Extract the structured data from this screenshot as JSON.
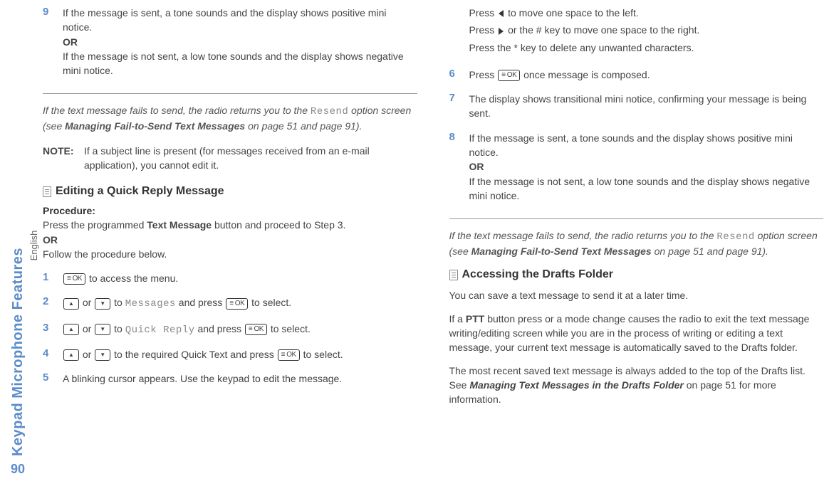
{
  "sidebar": {
    "title": "Keypad Microphone Features",
    "language": "English",
    "page_number": "90"
  },
  "left": {
    "step9_num": "9",
    "step9_text_a": "If the message is sent, a tone sounds and the display shows positive mini notice.",
    "step9_or": "OR",
    "step9_text_b": "If the message is not sent, a low tone sounds and the display shows negative mini notice.",
    "fail_note_a": "If the text message fails to send, the radio returns you to the ",
    "fail_note_code": "Resend",
    "fail_note_b": " option screen (see ",
    "fail_note_bold": "Managing Fail-to-Send Text Messages",
    "fail_note_c": " on page 51 and page 91).",
    "note_label": "NOTE:",
    "note_text": "If a subject line is present (for messages received from an e-mail application), you cannot edit it.",
    "heading": "Editing a Quick Reply Message",
    "proc_label": "Procedure:",
    "proc_intro_a": "Press the programmed ",
    "proc_intro_bold": "Text Message",
    "proc_intro_b": " button and proceed to Step 3.",
    "proc_or": "OR",
    "proc_follow": "Follow the procedure below.",
    "s1_num": "1",
    "s1_text": " to access the menu.",
    "s2_num": "2",
    "s2_a": " or ",
    "s2_b": " to ",
    "s2_code": "Messages",
    "s2_c": " and press ",
    "s2_d": " to select.",
    "s3_num": "3",
    "s3_a": " or ",
    "s3_b": " to ",
    "s3_code": "Quick Reply",
    "s3_c": " and press ",
    "s3_d": " to select.",
    "s4_num": "4",
    "s4_a": " or ",
    "s4_b": " to the required Quick Text and press ",
    "s4_c": " to select.",
    "s5_num": "5",
    "s5_text": "A blinking cursor appears. Use the keypad to edit the message."
  },
  "right": {
    "line1_a": "Press ",
    "line1_b": " to move one space to the left.",
    "line2_a": "Press ",
    "line2_b": " or the # key to move one space to the right.",
    "line3": "Press the * key to delete any unwanted characters.",
    "s6_num": "6",
    "s6_a": "Press ",
    "s6_b": " once message is composed.",
    "s7_num": "7",
    "s7_text": "The display shows transitional mini notice, confirming your message is being sent.",
    "s8_num": "8",
    "s8_a": "If the message is sent, a tone sounds and the display shows positive mini notice.",
    "s8_or": "OR",
    "s8_b": "If the message is not sent, a low tone sounds and the display shows negative mini notice.",
    "fail_note_a": "If the text message fails to send, the radio returns you to the ",
    "fail_note_code": "Resend",
    "fail_note_b": " option screen (see ",
    "fail_note_bold": "Managing Fail-to-Send Text Messages",
    "fail_note_c": " on page 51 and page 91).",
    "heading2": "Accessing the Drafts Folder",
    "drafts_intro": "You can save a text message to send it at a later time.",
    "drafts_p2_a": "If a ",
    "drafts_p2_bold": "PTT",
    "drafts_p2_b": " button press or a mode change causes the radio to exit the text message writing/editing screen while you are in the process of writing or editing a text message, your current text message is automatically saved to the Drafts folder.",
    "drafts_p3_a": "The most recent saved text message is always added to the top of the Drafts list. See ",
    "drafts_p3_bold": "Managing Text Messages in the Drafts Folder",
    "drafts_p3_b": " on page 51 for more information."
  },
  "keys": {
    "ok": "≡ OK"
  }
}
